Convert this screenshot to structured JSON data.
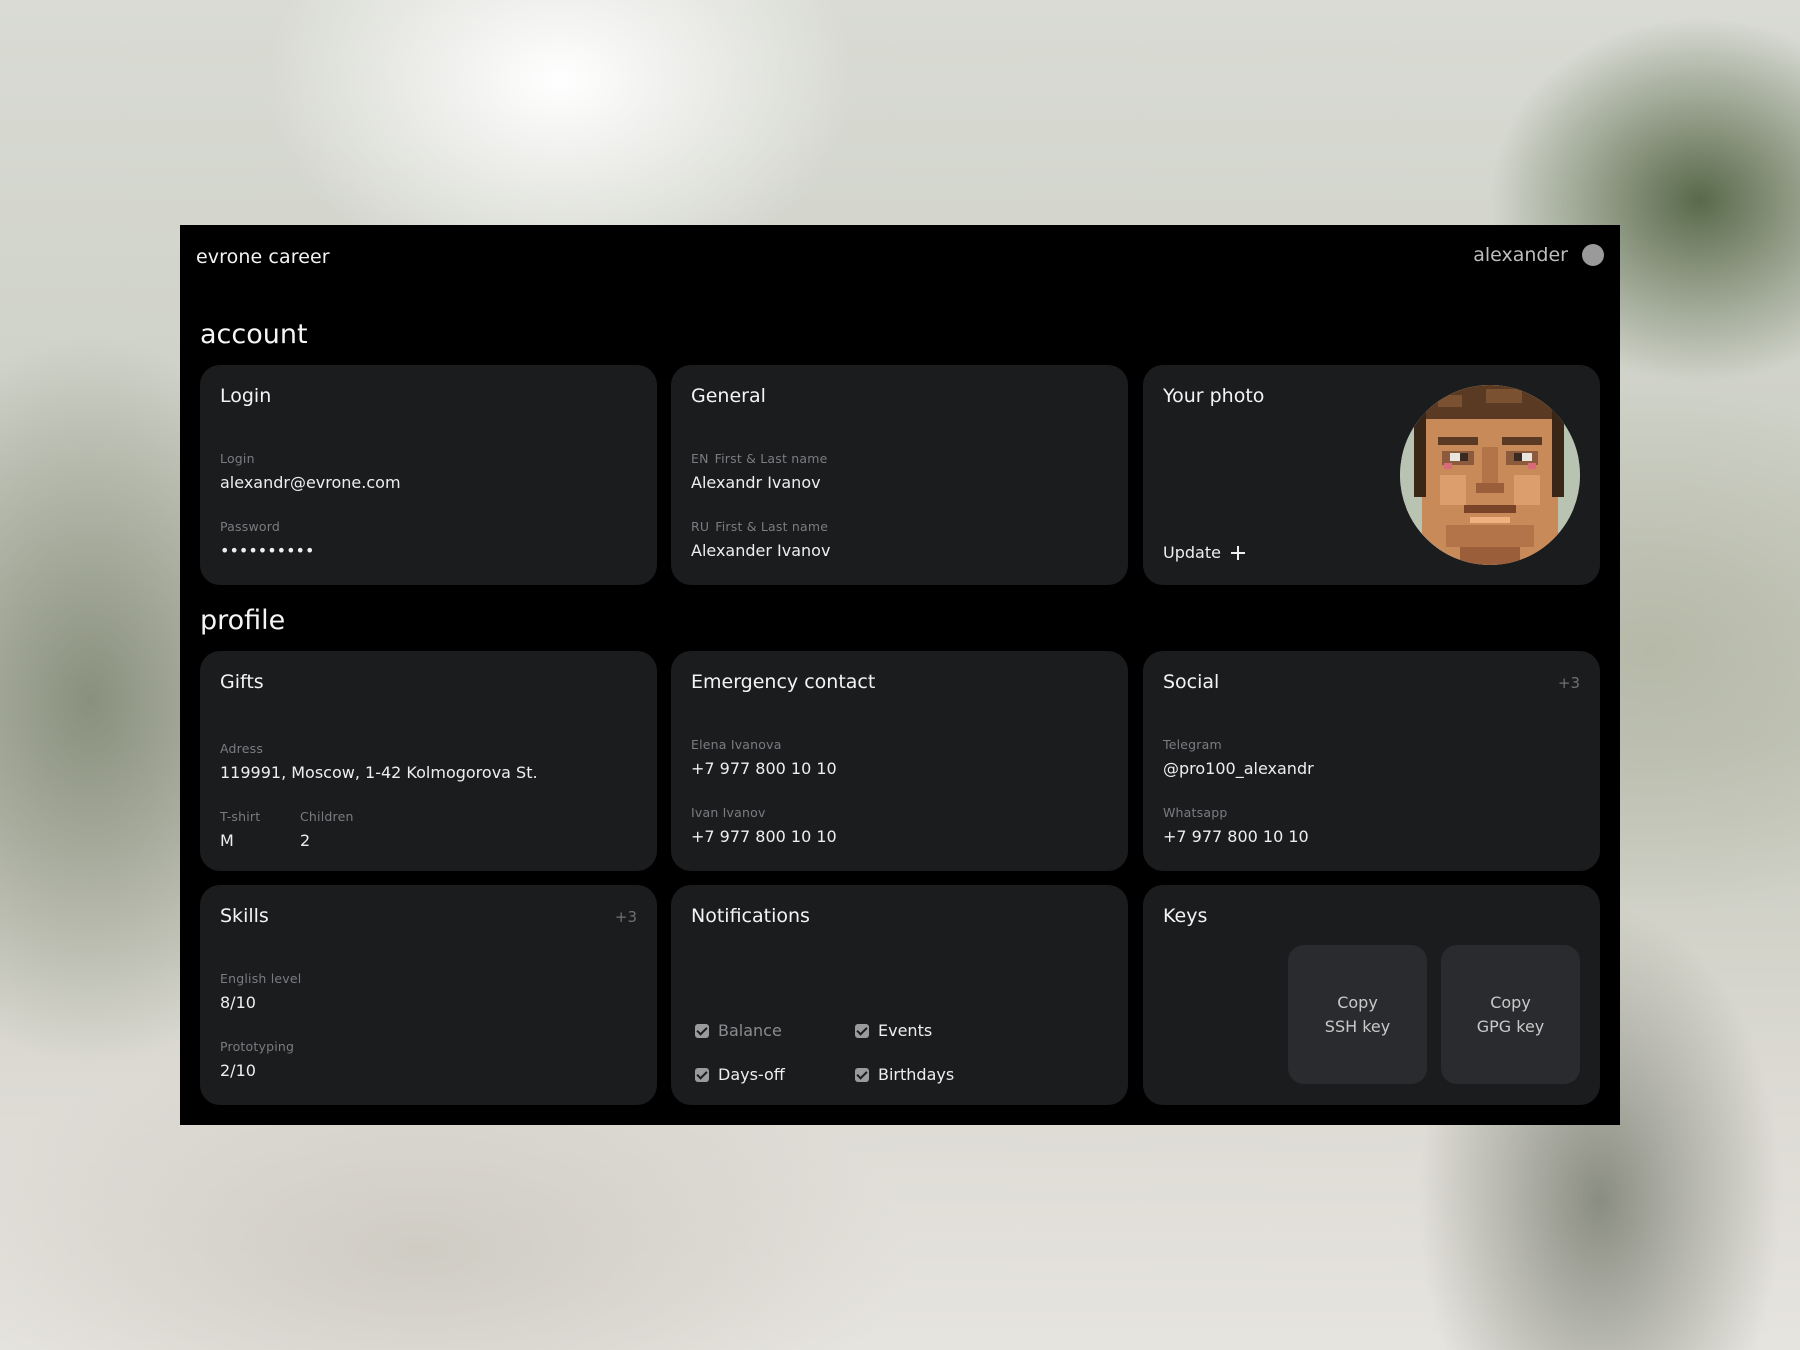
{
  "header": {
    "brand": "evrone career",
    "user_name": "alexander"
  },
  "sections": {
    "account": "account",
    "profile": "profile"
  },
  "login_card": {
    "title": "Login",
    "login_label": "Login",
    "login_value": "alexandr@evrone.com",
    "password_label": "Password",
    "password_value": "••••••••••"
  },
  "general_card": {
    "title": "General",
    "en_lang": "EN",
    "en_label": "First & Last name",
    "en_value": "Alexandr Ivanov",
    "ru_lang": "RU",
    "ru_label": "First & Last name",
    "ru_value": "Alexander Ivanov"
  },
  "photo_card": {
    "title": "Your photo",
    "update_label": "Update"
  },
  "gifts_card": {
    "title": "Gifts",
    "address_label": "Adress",
    "address_value": "119991, Moscow, 1-42 Kolmogorova St.",
    "tshirt_label": "T-shirt",
    "tshirt_value": "M",
    "children_label": "Children",
    "children_value": "2"
  },
  "emergency_card": {
    "title": "Emergency contact",
    "contacts": [
      {
        "name": "Elena Ivanova",
        "phone": "+7 977 800 10 10"
      },
      {
        "name": "Ivan Ivanov",
        "phone": "+7 977 800 10 10"
      }
    ]
  },
  "social_card": {
    "title": "Social",
    "extra": "+3",
    "telegram_label": "Telegram",
    "telegram_value": "@pro100_alexandr",
    "whatsapp_label": "Whatsapp",
    "whatsapp_value": "+7 977 800 10 10"
  },
  "skills_card": {
    "title": "Skills",
    "extra": "+3",
    "english_label": "English level",
    "english_value": "8/10",
    "prototyping_label": "Prototyping",
    "prototyping_value": "2/10"
  },
  "notifications_card": {
    "title": "Notifications",
    "items": [
      {
        "label": "Balance",
        "checked": true
      },
      {
        "label": "Events",
        "checked": true
      },
      {
        "label": "Days-off",
        "checked": true
      },
      {
        "label": "Birthdays",
        "checked": true
      }
    ]
  },
  "keys_card": {
    "title": "Keys",
    "ssh_line1": "Copy",
    "ssh_line2": "SSH key",
    "gpg_line1": "Copy",
    "gpg_line2": "GPG key"
  },
  "colors": {
    "window_bg": "#000000",
    "card_bg": "#1b1c1e",
    "key_button_bg": "#2a2b2e",
    "muted_text": "#7b7c80"
  },
  "icons": {
    "user_status": "user-status-dot-icon",
    "update": "plus-icon",
    "checkbox": "checkbox-checked-icon"
  }
}
